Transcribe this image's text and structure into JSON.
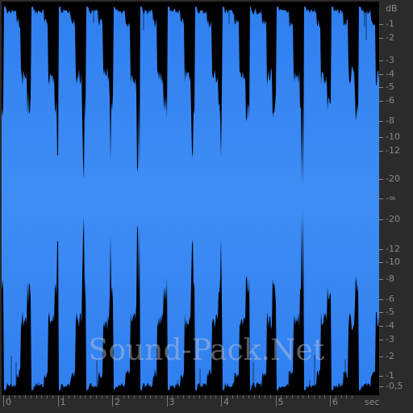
{
  "waveform": {
    "fill_top": "#2f7ff0",
    "fill_bottom": "#3f8df5",
    "background": "#000000",
    "duration_sec": 6.8
  },
  "db_scale": {
    "unit": "dB",
    "top_labels": [
      "-1",
      "-2",
      "-3",
      "-4",
      "-5",
      "-6",
      "-8",
      "-10",
      "-12",
      "-20"
    ],
    "center_label": "-∞",
    "bottom_labels": [
      "-20",
      "-12",
      "-10",
      "-8",
      "-6",
      "-5",
      "-4",
      "-3",
      "-2",
      "-1",
      "-0,5"
    ]
  },
  "time_ruler": {
    "labels": [
      "0",
      "1",
      "2",
      "3",
      "4",
      "5",
      "6"
    ],
    "unit": "sec"
  },
  "watermark": "Sound-Pack.Net"
}
